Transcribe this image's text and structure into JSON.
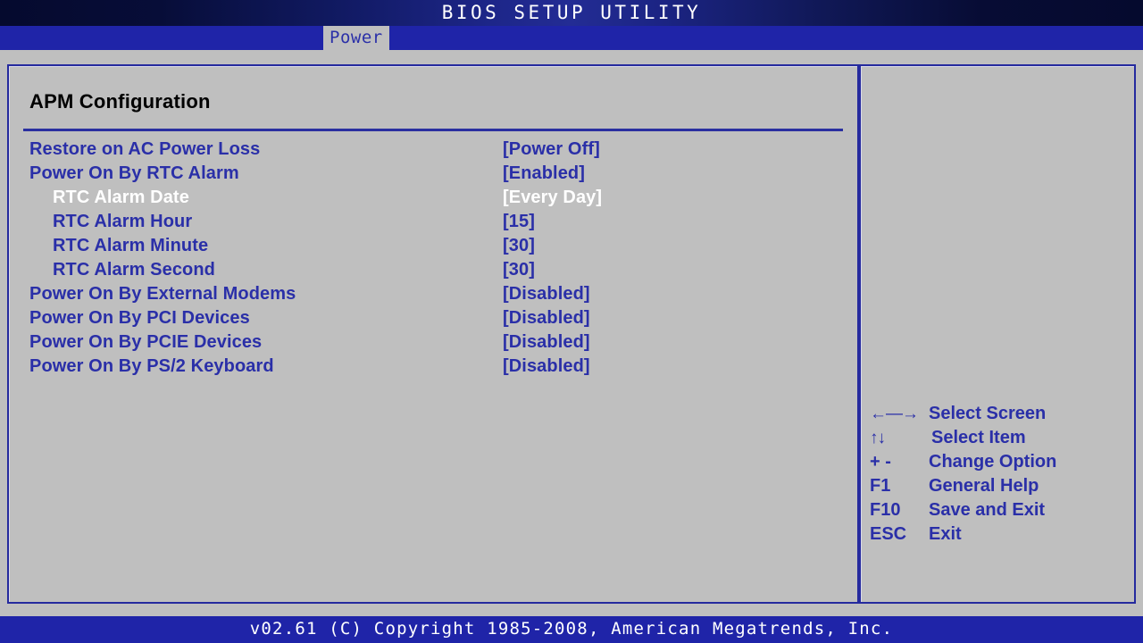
{
  "titlebar": {
    "title": "BIOS SETUP UTILITY"
  },
  "tabs": [
    {
      "label": "Power",
      "active": true
    }
  ],
  "main": {
    "section_title": "APM Configuration",
    "settings": [
      {
        "label": "Restore on AC Power Loss",
        "value": "[Power Off]",
        "indent": false,
        "selected": false
      },
      {
        "label": "Power On By RTC Alarm",
        "value": "[Enabled]",
        "indent": false,
        "selected": false
      },
      {
        "label": "RTC Alarm Date",
        "value": "[Every Day]",
        "indent": true,
        "selected": true
      },
      {
        "label": "RTC Alarm Hour",
        "value": "[15]",
        "indent": true,
        "selected": false
      },
      {
        "label": "RTC Alarm Minute",
        "value": "[30]",
        "indent": true,
        "selected": false
      },
      {
        "label": "RTC Alarm Second",
        "value": "[30]",
        "indent": true,
        "selected": false
      },
      {
        "label": "Power On By External Modems",
        "value": "[Disabled]",
        "indent": false,
        "selected": false
      },
      {
        "label": "Power On By PCI Devices",
        "value": "[Disabled]",
        "indent": false,
        "selected": false
      },
      {
        "label": "Power On By PCIE Devices",
        "value": "[Disabled]",
        "indent": false,
        "selected": false
      },
      {
        "label": "Power On By PS/2 Keyboard",
        "value": "[Disabled]",
        "indent": false,
        "selected": false
      }
    ]
  },
  "help": {
    "legend": [
      {
        "key": "←—→",
        "desc": "Select Screen",
        "icon": "left-right-arrow-icon",
        "arrows": true,
        "shift": false
      },
      {
        "key": "↑↓",
        "desc": "Select Item",
        "icon": "up-down-arrow-icon",
        "arrows": true,
        "shift": true
      },
      {
        "key": "+ -",
        "desc": "Change Option",
        "icon": "plus-minus-key",
        "arrows": false,
        "shift": false
      },
      {
        "key": "F1",
        "desc": "General Help",
        "icon": "f1-key",
        "arrows": false,
        "shift": false
      },
      {
        "key": "F10",
        "desc": "Save and Exit",
        "icon": "f10-key",
        "arrows": false,
        "shift": false
      },
      {
        "key": "ESC",
        "desc": "Exit",
        "icon": "esc-key",
        "arrows": false,
        "shift": false
      }
    ]
  },
  "footer": {
    "text": "v02.61 (C) Copyright 1985-2008, American Megatrends, Inc."
  },
  "colors": {
    "screen_bg": "#bfbfbf",
    "accent_blue": "#2a2fa8",
    "bar_blue": "#1f24a8",
    "navy_dark": "#050a2e",
    "selected_text": "#ffffff",
    "heading_text": "#000000"
  }
}
